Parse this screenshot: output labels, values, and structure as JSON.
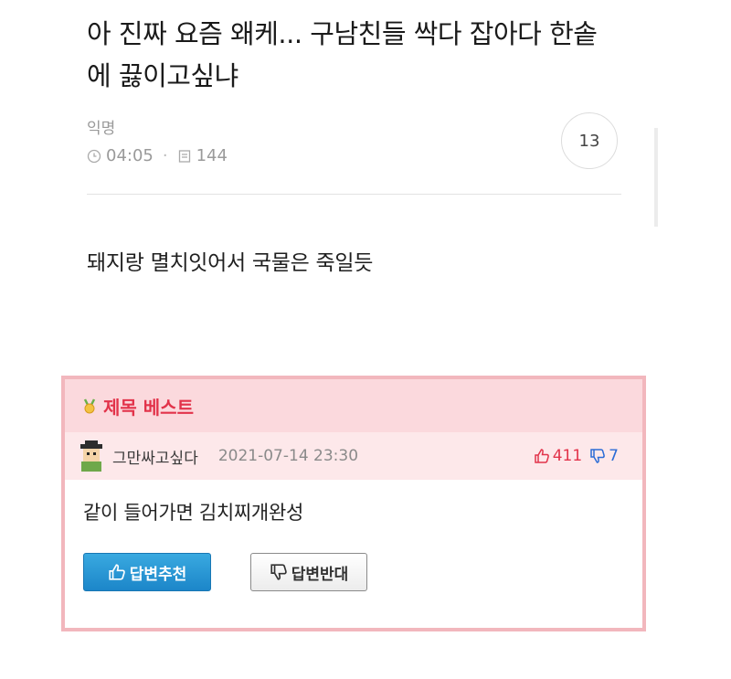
{
  "post": {
    "title_line1": "아 진짜 요즘 왜케... 구남친들 싹다 잡아다 한솥",
    "title_line2": "에 끓이고싶냐",
    "author": "익명",
    "time": "04:05",
    "views": "144",
    "comment_count": "13",
    "body": "돼지랑 멸치잇어서 국물은 죽일듯"
  },
  "best": {
    "header": "제목 베스트",
    "author": "그만싸고싶다",
    "date": "2021-07-14 23:30",
    "upvotes": "411",
    "downvotes": "7",
    "content": "같이 들어가면 김치찌개완성",
    "recommend_label": "답변추천",
    "oppose_label": "답변반대"
  },
  "icons": {
    "clock": "clock-icon",
    "views": "document-icon",
    "medal": "medal-icon",
    "thumbs_up": "thumbs-up-icon",
    "thumbs_down": "thumbs-down-icon"
  },
  "colors": {
    "best_accent": "#e2334a",
    "best_border": "#f2b7bd",
    "best_header_bg": "#fbd9dd",
    "downvote": "#2b6cd6",
    "recommend_button": "#1c86c9"
  }
}
